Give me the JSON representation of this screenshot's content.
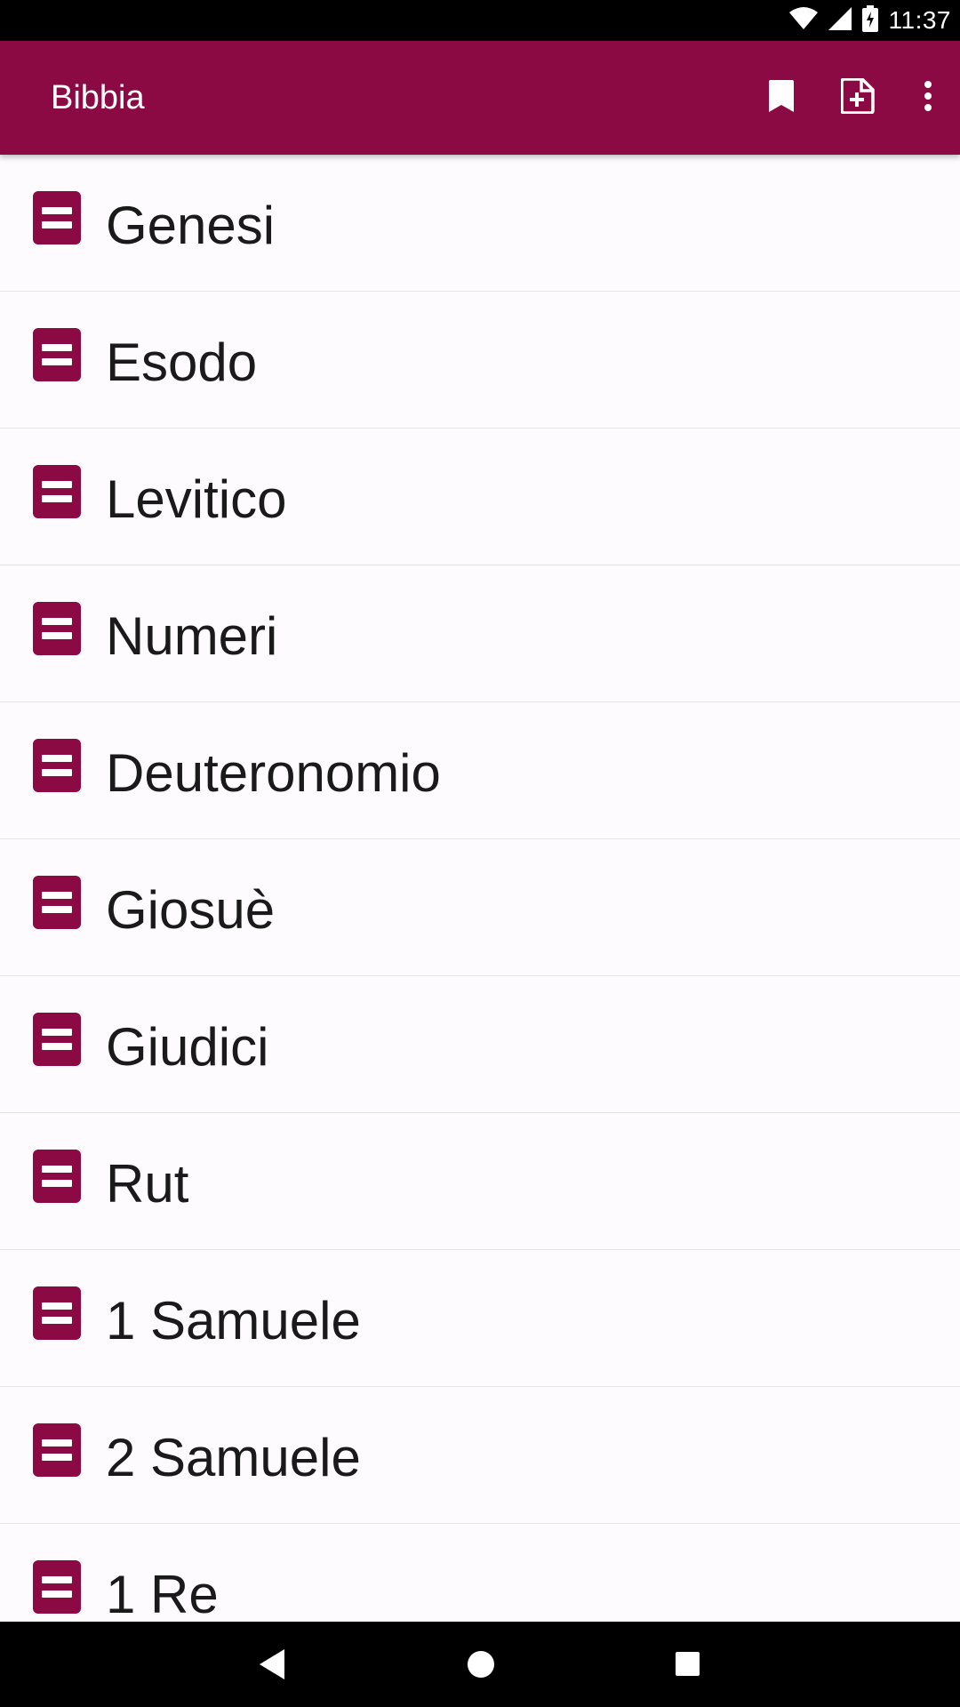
{
  "colors": {
    "primary": "#8c0a44",
    "status_bar": "#000000",
    "nav_bar": "#000000",
    "list_background": "#fdfbfd",
    "divider": "#e6e3e6",
    "text": "#1a1a1a"
  },
  "status_bar": {
    "time": "11:37",
    "icons": [
      "wifi-icon",
      "cell-signal-icon",
      "battery-charging-icon"
    ]
  },
  "app_bar": {
    "title": "Bibbia",
    "actions": [
      {
        "name": "bookmark-icon"
      },
      {
        "name": "add-document-icon"
      },
      {
        "name": "more-vert-icon"
      }
    ]
  },
  "books": [
    {
      "label": "Genesi"
    },
    {
      "label": "Esodo"
    },
    {
      "label": "Levitico"
    },
    {
      "label": "Numeri"
    },
    {
      "label": "Deuteronomio"
    },
    {
      "label": "Giosuè"
    },
    {
      "label": "Giudici"
    },
    {
      "label": "Rut"
    },
    {
      "label": "1 Samuele"
    },
    {
      "label": "2 Samuele"
    },
    {
      "label": "1 Re"
    }
  ],
  "nav_bar": {
    "buttons": [
      "back-icon",
      "home-icon",
      "recents-icon"
    ]
  }
}
